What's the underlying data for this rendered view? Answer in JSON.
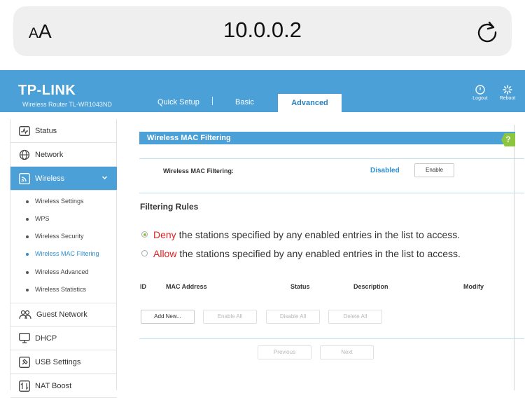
{
  "browser": {
    "aa_small": "A",
    "aa_large": "A",
    "url": "10.0.0.2"
  },
  "header": {
    "logo": "TP-LINK",
    "model": "Wireless Router TL-WR1043ND",
    "tabs": [
      "Quick Setup",
      "Basic",
      "Advanced"
    ],
    "active_tab": "Advanced",
    "logout_label": "Logout",
    "reboot_label": "Reboot",
    "accent_color": "#4ba0d8"
  },
  "sidebar": {
    "items": [
      {
        "label": "Status",
        "icon": "status-icon"
      },
      {
        "label": "Network",
        "icon": "globe-icon"
      },
      {
        "label": "Wireless",
        "icon": "wireless-icon",
        "active": true
      },
      {
        "label": "Guest Network",
        "icon": "guest-icon"
      },
      {
        "label": "DHCP",
        "icon": "monitor-icon"
      },
      {
        "label": "USB Settings",
        "icon": "usb-icon"
      },
      {
        "label": "NAT Boost",
        "icon": "nat-icon"
      }
    ],
    "sub_items": [
      "Wireless Settings",
      "WPS",
      "Wireless Security",
      "Wireless MAC Filtering",
      "Wireless Advanced",
      "Wireless Statistics"
    ],
    "current_sub": "Wireless MAC Filtering"
  },
  "main": {
    "section_title": "Wireless MAC Filtering",
    "help": "?",
    "filter_label": "Wireless MAC Filtering:",
    "filter_status": "Disabled",
    "enable_button": "Enable",
    "rules_title": "Filtering Rules",
    "rules": [
      {
        "keyword": "Deny",
        "text": " the stations specified by any enabled entries in the list to access.",
        "selected": true
      },
      {
        "keyword": "Allow",
        "text": " the stations specified by any enabled entries in the list to access.",
        "selected": false
      }
    ],
    "table_headers": [
      "ID",
      "MAC Address",
      "Status",
      "Description",
      "Modify"
    ],
    "buttons": {
      "add_new": "Add New...",
      "enable_all": "Enable All",
      "disable_all": "Disable All",
      "delete_all": "Delete All",
      "previous": "Previous",
      "next": "Next"
    }
  }
}
